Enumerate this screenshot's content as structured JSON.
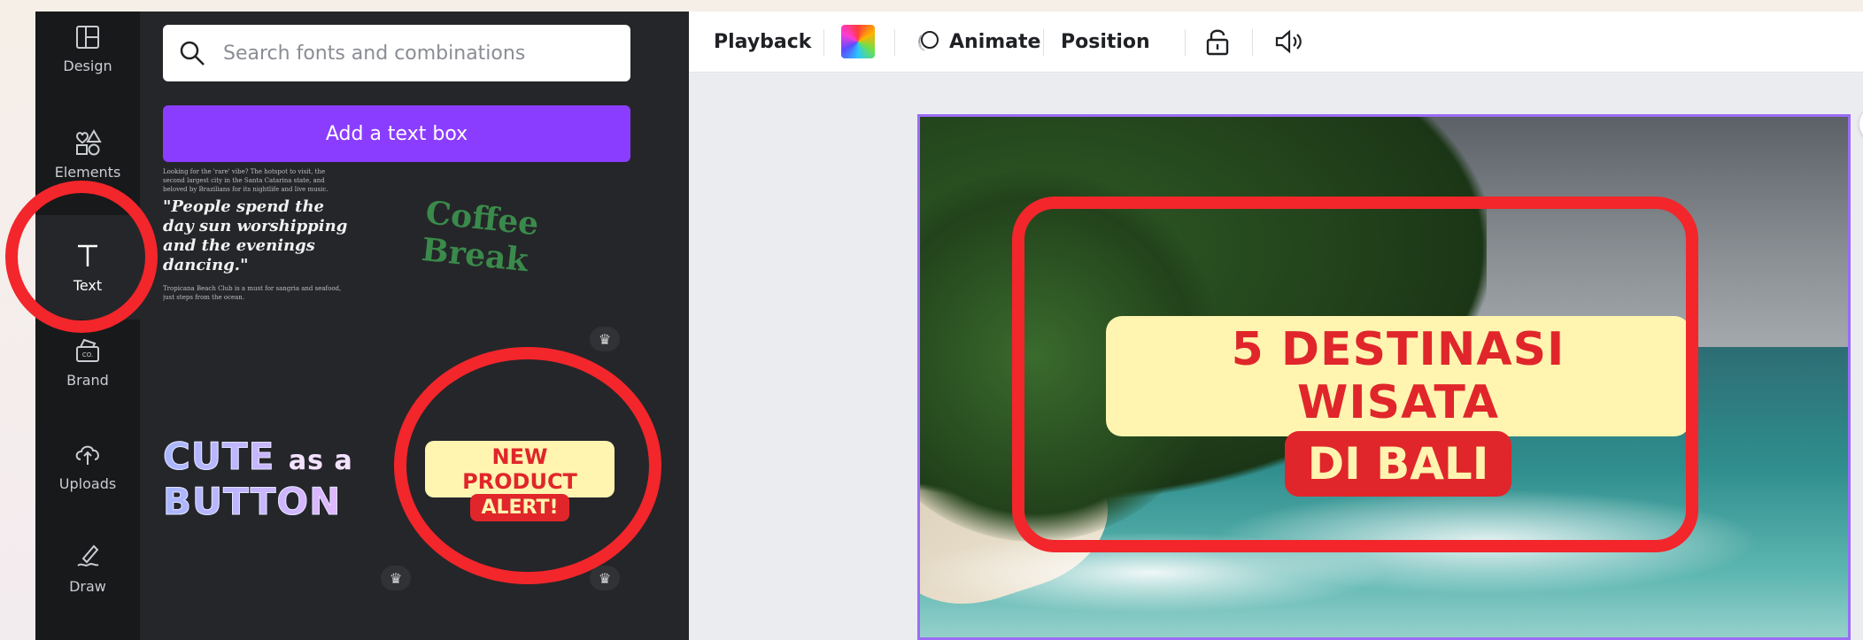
{
  "rail": {
    "items": [
      {
        "label": "Design",
        "icon": "layout-icon"
      },
      {
        "label": "Elements",
        "icon": "shapes-icon"
      },
      {
        "label": "Text",
        "icon": "text-icon"
      },
      {
        "label": "Brand",
        "icon": "brand-icon"
      },
      {
        "label": "Uploads",
        "icon": "cloud-upload-icon"
      },
      {
        "label": "Draw",
        "icon": "pen-icon"
      }
    ]
  },
  "panel": {
    "search_placeholder": "Search fonts and combinations",
    "add_text_box": "Add a text box",
    "presets": {
      "tiny_top": "Looking for the 'rare' vibe? The hotspot to visit, the second largest city in the Santa Catarina state, and beloved by Brazilians for its nightlife and live music.",
      "quote": "\"People spend the day sun worshipping and the evenings dancing.\"",
      "tiny_bottom": "Tropicana Beach Club is a must for sangria and seafood, just steps from the ocean.",
      "coffee": "Coffee Break",
      "cute_line1": "CUTE",
      "cute_asa": "as a",
      "cute_line2": "BUTTON",
      "np_line1": "NEW PRODUCT",
      "np_line2": "ALERT!"
    },
    "crown_icon": "crown-icon"
  },
  "toolbar": {
    "playback": "Playback",
    "animate": "Animate",
    "position": "Position",
    "lock_icon": "lock-icon",
    "audio_icon": "volume-icon",
    "color_icon": "color-swatch-icon"
  },
  "canvas": {
    "title_line1": "5 DESTINASI WISATA",
    "title_line2": "DI BALI"
  },
  "colors": {
    "accent": "#8b3dff",
    "annotation": "#f2262b",
    "title_bg": "#fff4b0",
    "title_red": "#e0262a"
  }
}
